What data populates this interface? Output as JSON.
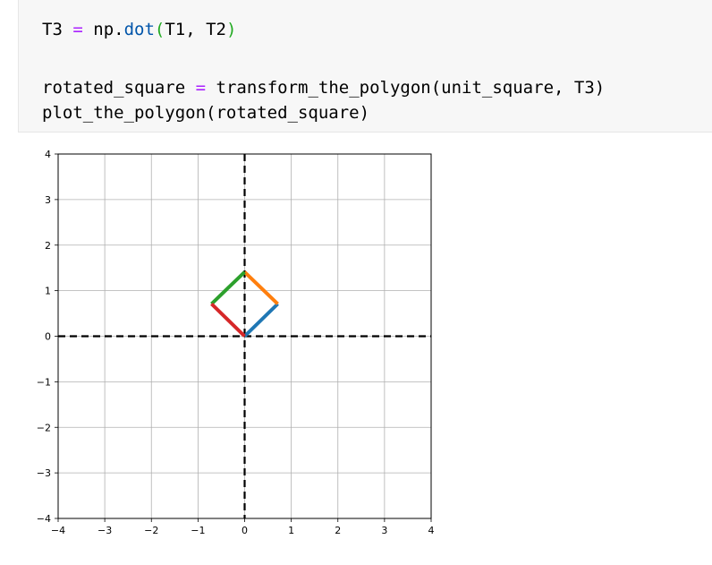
{
  "code": {
    "line1": {
      "var": "T3",
      "op": "=",
      "obj": "np.",
      "fn": "dot",
      "open": "(",
      "args": "T1, T2",
      "close": ")"
    },
    "line2": {
      "var": "rotated_square",
      "op": "=",
      "call": "transform_the_polygon(unit_square, T3)"
    },
    "line3": "plot_the_polygon(rotated_square)"
  },
  "chart_data": {
    "type": "line",
    "xlim": [
      -4,
      4
    ],
    "ylim": [
      -4,
      4
    ],
    "xticks": [
      "−4",
      "−3",
      "−2",
      "−1",
      "0",
      "1",
      "2",
      "3",
      "4"
    ],
    "yticks": [
      "4",
      "3",
      "2",
      "1",
      "0",
      "−1",
      "−2",
      "−3",
      "−4"
    ],
    "grid": true,
    "axes_lines": {
      "style": "dashed",
      "color": "#000000"
    },
    "series": [
      {
        "color": "#1f77b4",
        "points": [
          [
            0,
            0
          ],
          [
            0.71,
            0.71
          ]
        ]
      },
      {
        "color": "#ff7f0e",
        "points": [
          [
            0.71,
            0.71
          ],
          [
            0,
            1.41
          ]
        ]
      },
      {
        "color": "#2ca02c",
        "points": [
          [
            0,
            1.41
          ],
          [
            -0.71,
            0.71
          ]
        ]
      },
      {
        "color": "#d62728",
        "points": [
          [
            -0.71,
            0.71
          ],
          [
            0,
            0
          ]
        ]
      }
    ]
  }
}
